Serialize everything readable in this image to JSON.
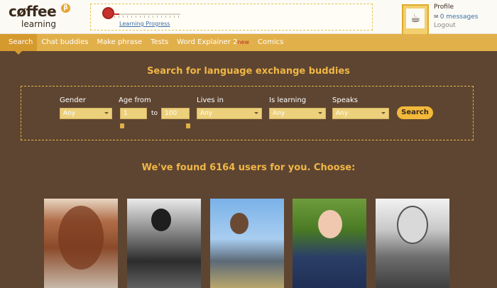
{
  "header": {
    "logo_word": "cøffee",
    "logo_sub": "learning",
    "logo_badge": "β",
    "progress_link": "Learning Progress",
    "progress_fraction": 0.08,
    "profile_label": "Profile",
    "messages_label": "0 messages",
    "logout_label": "Logout"
  },
  "nav": {
    "items": [
      {
        "label": "Search"
      },
      {
        "label": "Chat buddies"
      },
      {
        "label": "Make phrase"
      },
      {
        "label": "Tests"
      },
      {
        "label": "Word Explainer 2",
        "badge": "new"
      },
      {
        "label": "Comics"
      }
    ]
  },
  "search": {
    "title": "Search for language exchange buddies",
    "gender_label": "Gender",
    "gender_value": "Any",
    "age_label": "Age from",
    "age_from": "1",
    "age_to_label": "to",
    "age_to": "100",
    "lives_label": "Lives in",
    "lives_value": "Any",
    "learning_label": "Is learning",
    "learning_value": "Any",
    "speaks_label": "Speaks",
    "speaks_value": "Any",
    "button_label": "Search"
  },
  "results": {
    "found_text": "We've found 6164 users for you. Choose:"
  },
  "colors": {
    "background": "#5e4531",
    "accent": "#f0b646",
    "nav": "#e2b04a"
  }
}
